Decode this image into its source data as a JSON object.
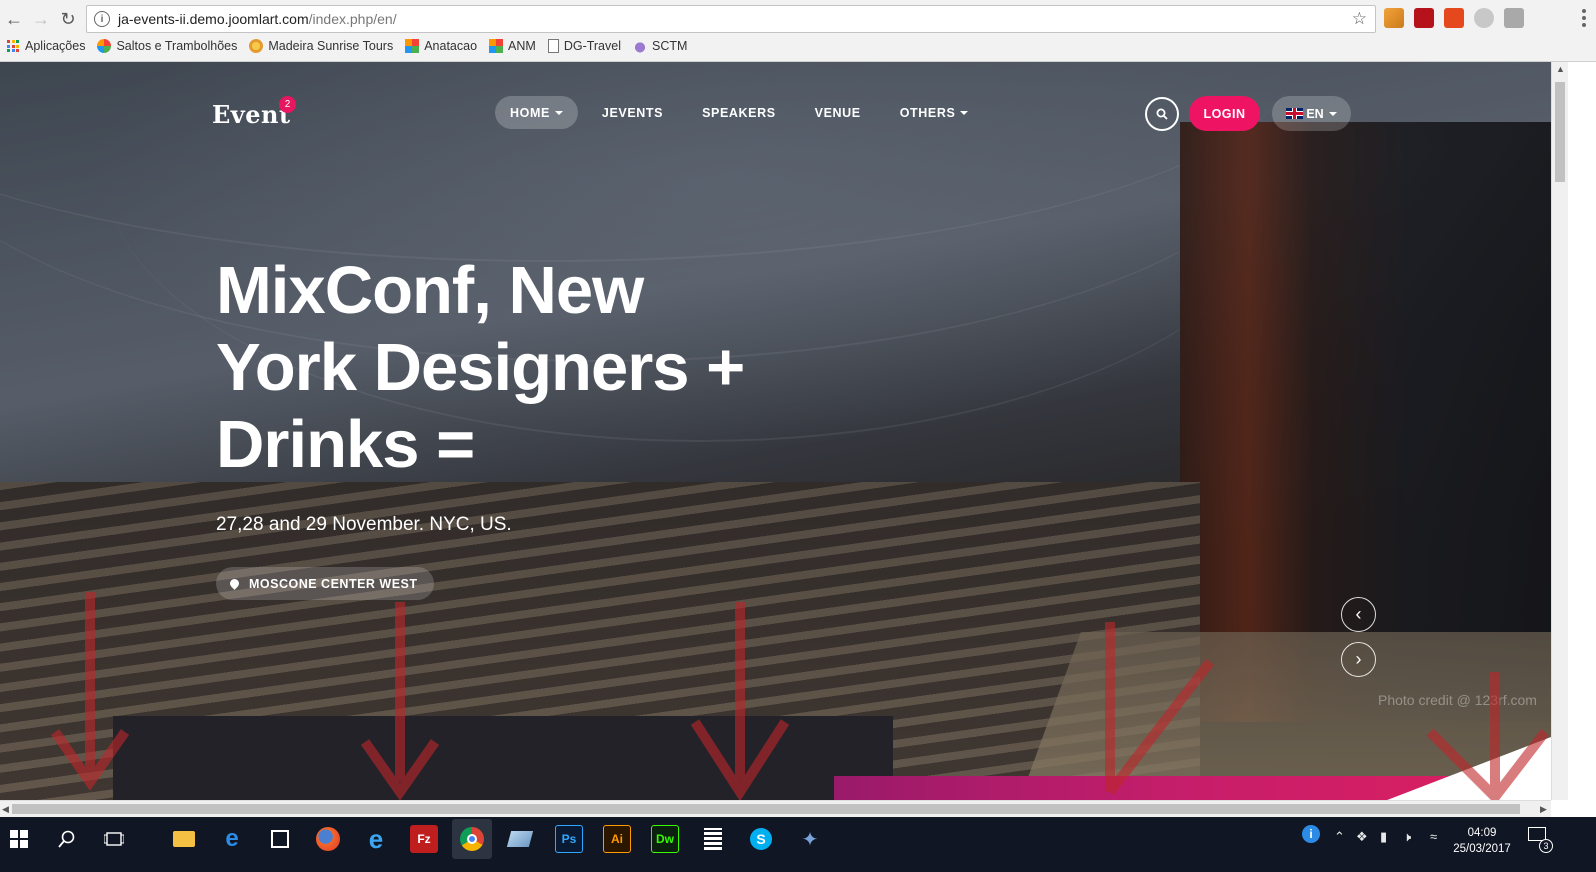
{
  "browser": {
    "url_host": "ja-events-ii.demo.joomlart.com",
    "url_path": "/index.php/en/",
    "bookmarks": [
      {
        "label": "Aplicações",
        "icon": "apps-grid-icon"
      },
      {
        "label": "Saltos e Trambolhões",
        "icon": "joomla-icon"
      },
      {
        "label": "Madeira Sunrise Tours",
        "icon": "sun-icon"
      },
      {
        "label": "Anatacao",
        "icon": "joomla-icon"
      },
      {
        "label": "ANM",
        "icon": "joomla-icon"
      },
      {
        "label": "DG-Travel",
        "icon": "page-icon"
      },
      {
        "label": "SCTM",
        "icon": "cloud-icon"
      }
    ]
  },
  "site": {
    "logo": "Event",
    "logo_badge": "2",
    "menu": [
      {
        "label": "HOME",
        "has_caret": true,
        "active": true
      },
      {
        "label": "JEVENTS",
        "has_caret": false,
        "active": false
      },
      {
        "label": "SPEAKERS",
        "has_caret": false,
        "active": false
      },
      {
        "label": "VENUE",
        "has_caret": false,
        "active": false
      },
      {
        "label": "OTHERS",
        "has_caret": true,
        "active": false
      }
    ],
    "login_label": "LOGIN",
    "lang_label": "EN",
    "accent_color": "#ef1463"
  },
  "hero": {
    "title": "MixConf, New York Designers + Drinks =",
    "subtitle": "27,28 and 29 November. NYC, US.",
    "venue": "MOSCONE CENTER WEST",
    "photo_credit": "Photo credit @ 123rf.com"
  },
  "taskbar": {
    "time": "04:09",
    "date": "25/03/2017",
    "notification_count": "3",
    "apps": [
      "windows-start-icon",
      "search-icon",
      "task-view-icon",
      "file-explorer-icon",
      "edge-icon",
      "store-icon",
      "firefox-icon",
      "internet-explorer-icon",
      "filezilla-icon",
      "chrome-icon",
      "notepad-icon",
      "photoshop-icon",
      "illustrator-icon",
      "dreamweaver-icon",
      "calculator-icon",
      "skype-icon",
      "paint-icon"
    ],
    "app_labels": {
      "photoshop": "Ps",
      "illustrator": "Ai",
      "dreamweaver": "Dw",
      "filezilla": "Fz"
    }
  }
}
